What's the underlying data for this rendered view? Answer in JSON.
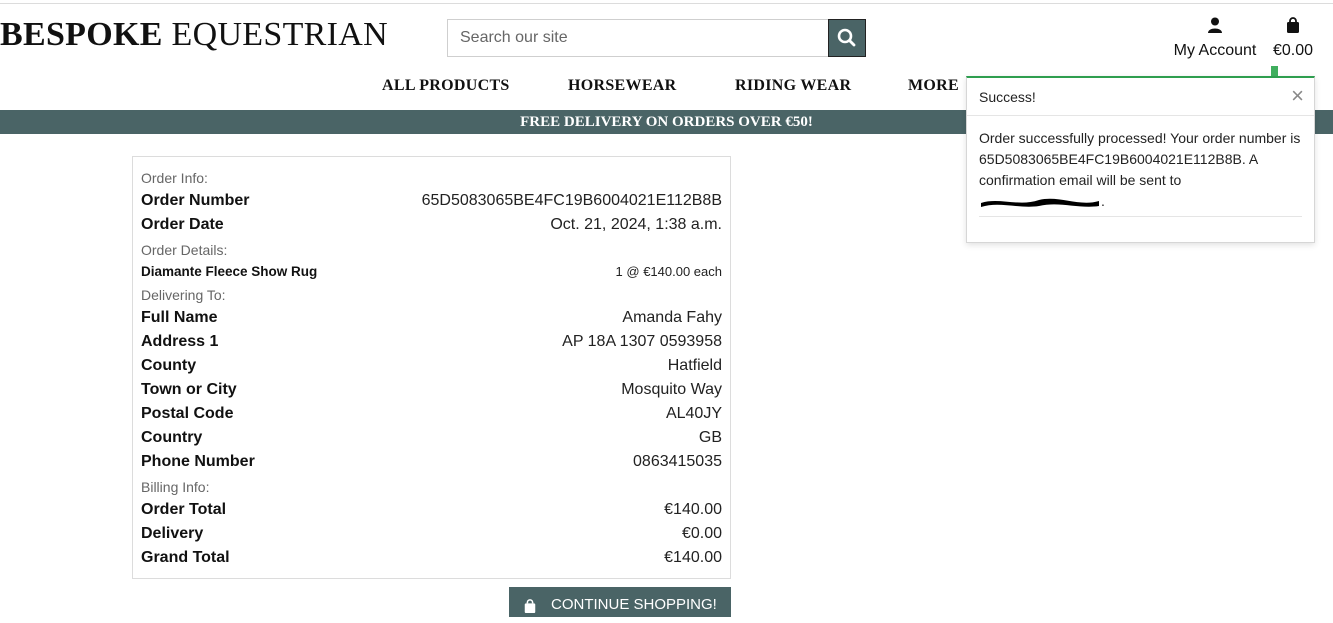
{
  "header": {
    "logo_bold": "BESPOKE",
    "logo_rest": " EQUESTRIAN",
    "search_placeholder": "Search our site",
    "account_label": "My Account",
    "bag_total": "€0.00"
  },
  "nav": {
    "items": [
      "ALL PRODUCTS",
      "HORSEWEAR",
      "RIDING WEAR",
      "MORE"
    ]
  },
  "banner": {
    "text": "FREE DELIVERY ON ORDERS OVER €50!"
  },
  "order": {
    "sections": {
      "info": "Order Info:",
      "details": "Order Details:",
      "delivering": "Delivering To:",
      "billing": "Billing Info:"
    },
    "info_rows": [
      {
        "label": "Order Number",
        "value": "65D5083065BE4FC19B6004021E112B8B"
      },
      {
        "label": "Order Date",
        "value": "Oct. 21, 2024, 1:38 a.m."
      }
    ],
    "items": [
      {
        "name": "Diamante Fleece Show Rug",
        "qty_price": "1 @ €140.00 each"
      }
    ],
    "delivery_rows": [
      {
        "label": "Full Name",
        "value": "Amanda Fahy"
      },
      {
        "label": "Address 1",
        "value": "AP 18A 1307 0593958"
      },
      {
        "label": "County",
        "value": "Hatfield"
      },
      {
        "label": "Town or City",
        "value": "Mosquito Way"
      },
      {
        "label": "Postal Code",
        "value": "AL40JY"
      },
      {
        "label": "Country",
        "value": "GB"
      },
      {
        "label": "Phone Number",
        "value": "0863415035"
      }
    ],
    "billing_rows": [
      {
        "label": "Order Total",
        "value": "€140.00"
      },
      {
        "label": "Delivery",
        "value": "€0.00"
      },
      {
        "label": "Grand Total",
        "value": "€140.00"
      }
    ],
    "continue_label": "CONTINUE SHOPPING!"
  },
  "toast": {
    "title": "Success!",
    "close": "×",
    "message": "Order successfully processed! Your order number is 65D5083065BE4FC19B6004021E112B8B. A confirmation email will be sent to",
    "message_end": "."
  },
  "colors": {
    "accent": "#4a6466",
    "success": "#2e9e4f"
  },
  "icons": {
    "search": "search-icon",
    "account": "user-icon",
    "bag": "shopping-bag-icon",
    "close": "close-icon"
  }
}
